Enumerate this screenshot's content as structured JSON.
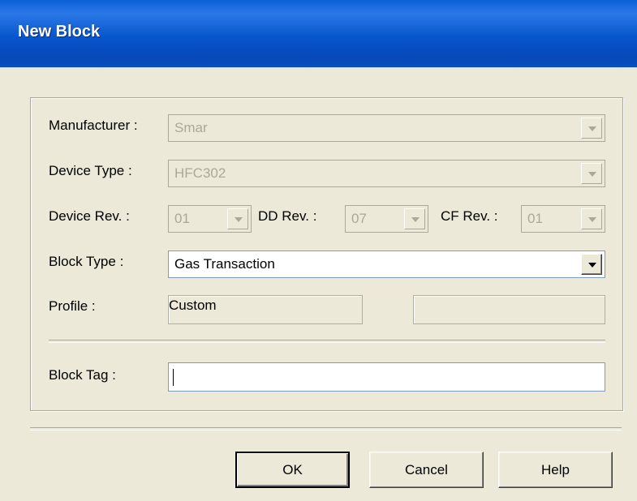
{
  "window": {
    "title": "New Block"
  },
  "form": {
    "manufacturer": {
      "label": "Manufacturer :",
      "value": "Smar"
    },
    "device_type": {
      "label": "Device Type :",
      "value": "HFC302"
    },
    "device_rev": {
      "label": "Device Rev. :",
      "value": "01"
    },
    "dd_rev": {
      "label": "DD Rev. :",
      "value": "07"
    },
    "cf_rev": {
      "label": "CF Rev. :",
      "value": "01"
    },
    "block_type": {
      "label": "Block Type :",
      "value": "Gas Transaction"
    },
    "profile": {
      "label": "Profile :",
      "value": "Custom",
      "value2": ""
    },
    "block_tag": {
      "label": "Block Tag :",
      "value": ""
    }
  },
  "buttons": {
    "ok": "OK",
    "cancel": "Cancel",
    "help": "Help"
  },
  "icons": {
    "dropdown": "chevron-down-icon"
  },
  "colors": {
    "titlebar": "#0856cc",
    "face": "#ece9d8",
    "disabled_text": "#aca899"
  }
}
